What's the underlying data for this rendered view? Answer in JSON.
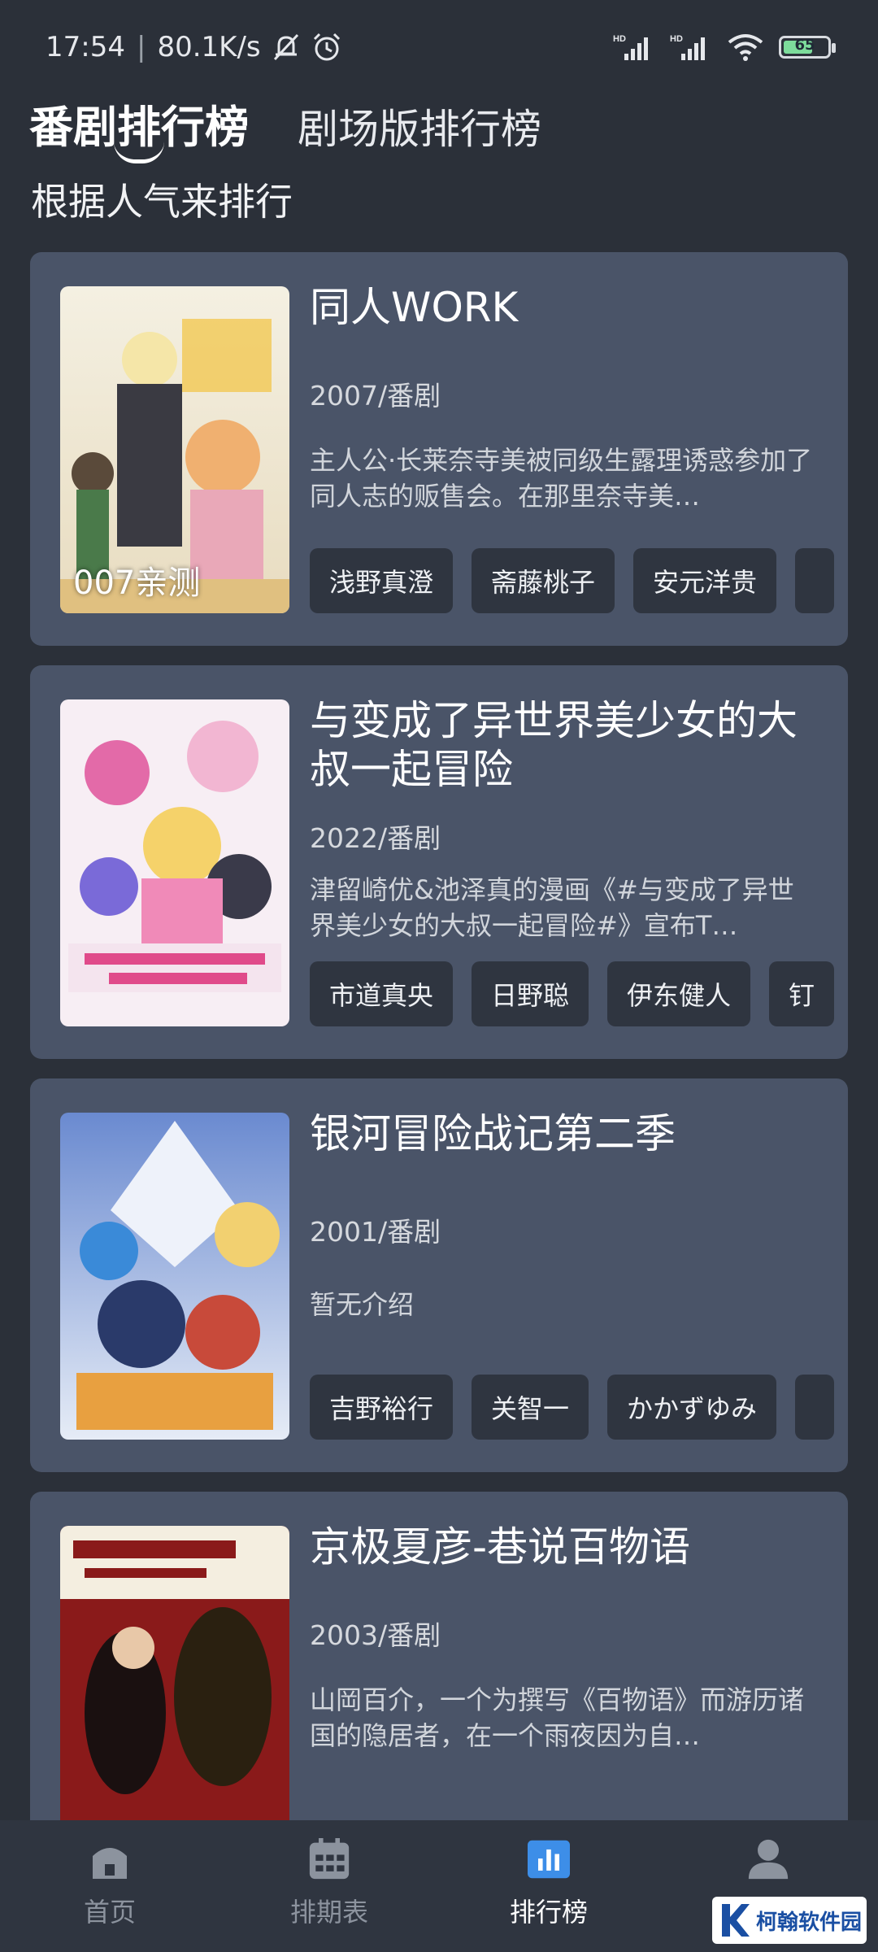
{
  "status": {
    "time": "17:54",
    "speed": "80.1K/s",
    "battery": "65"
  },
  "tabs": [
    {
      "label": "番剧排行榜",
      "active": true
    },
    {
      "label": "剧场版排行榜",
      "active": false
    }
  ],
  "subtitle": "根据人气来排行",
  "items": [
    {
      "title": "同人WORK",
      "meta": "2007/番剧",
      "desc": "主人公·长莱奈寺美被同级生露理诱惑参加了同人志的贩售会。在那里奈寺美…",
      "tags": [
        "浅野真澄",
        "斋藤桃子",
        "安元洋贵",
        ""
      ],
      "poster_caption": "007亲测"
    },
    {
      "title": "与变成了异世界美少女的大叔一起冒险",
      "meta": "2022/番剧",
      "desc": "津留崎优&池泽真的漫画《#与变成了异世界美少女的大叔一起冒险#》宣布T…",
      "tags": [
        "市道真央",
        "日野聪",
        "伊东健人",
        "钉"
      ]
    },
    {
      "title": "银河冒险战记第二季",
      "meta": "2001/番剧",
      "desc": "暂无介绍",
      "tags": [
        "吉野裕行",
        "关智一",
        "かかずゆみ",
        ""
      ]
    },
    {
      "title": "京极夏彦-巷说百物语",
      "meta": "2003/番剧",
      "desc": "山岡百介，一个为撰写《百物语》而游历诸国的隐居者，在一个雨夜因为自…",
      "tags": []
    }
  ],
  "nav": [
    {
      "label": "首页",
      "icon": "home-icon",
      "active": false
    },
    {
      "label": "排期表",
      "icon": "calendar-icon",
      "active": false
    },
    {
      "label": "排行榜",
      "icon": "chart-icon",
      "active": true
    },
    {
      "label": "我的",
      "icon": "profile-icon",
      "active": false
    }
  ],
  "watermark": "柯翰软件园"
}
